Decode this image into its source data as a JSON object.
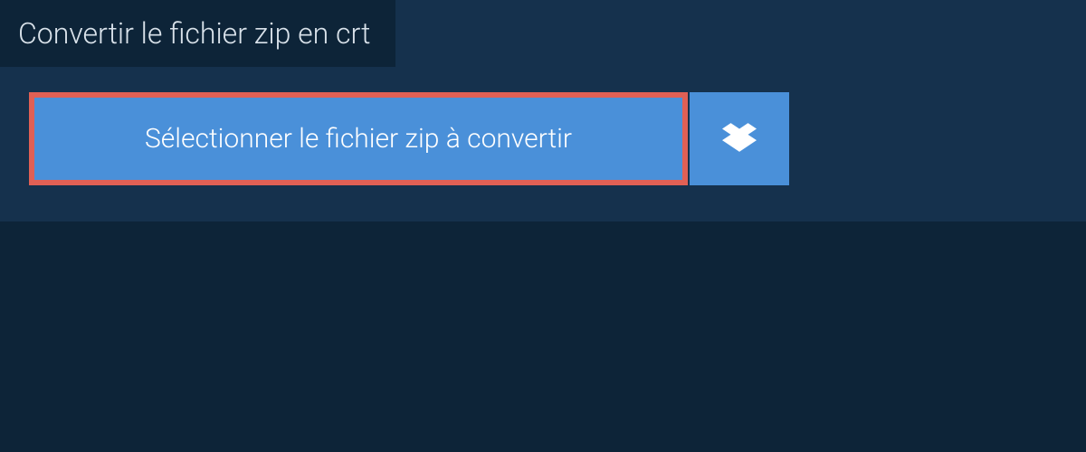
{
  "header": {
    "title": "Convertir le fichier zip en crt"
  },
  "actions": {
    "select_file_label": "Sélectionner le fichier zip à convertir"
  }
}
